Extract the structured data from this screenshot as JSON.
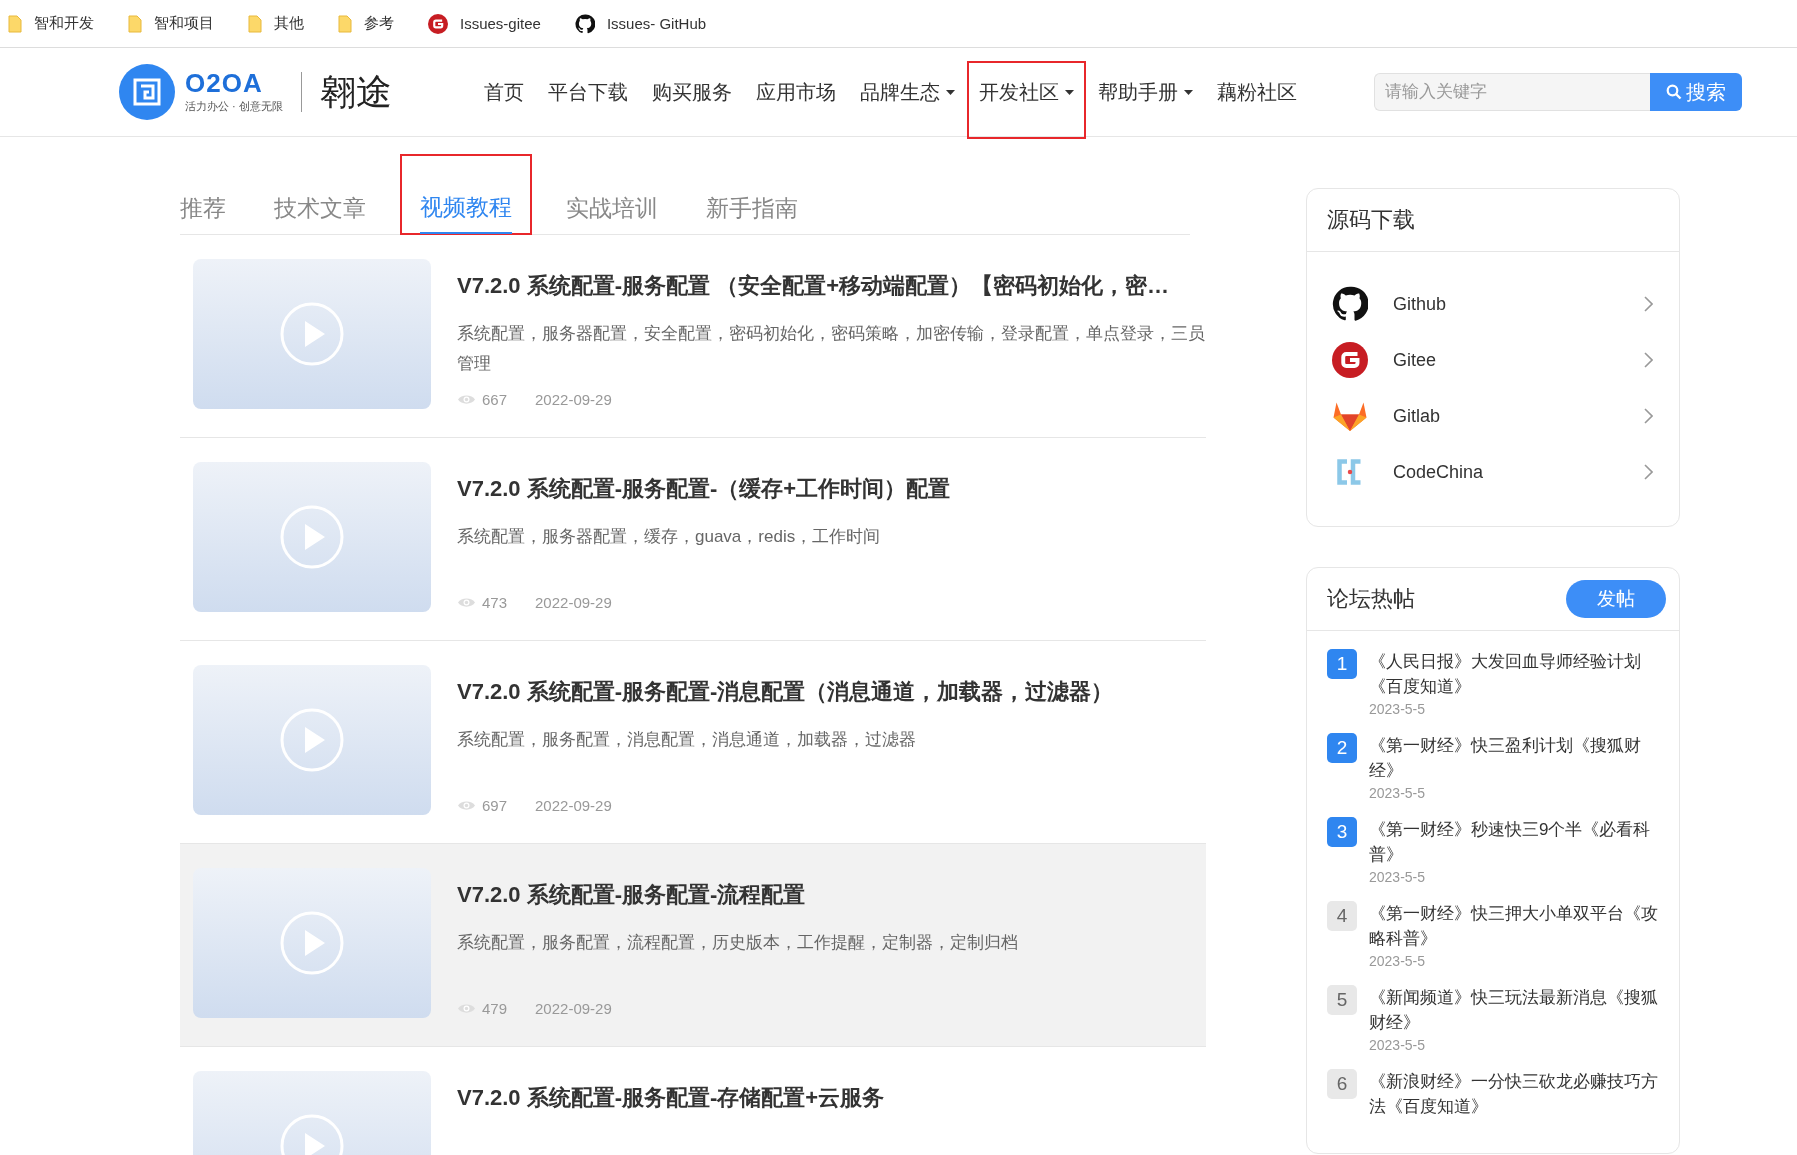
{
  "bookmarks": [
    {
      "kind": "folder",
      "label": "智和开发"
    },
    {
      "kind": "folder",
      "label": "智和项目"
    },
    {
      "kind": "folder",
      "label": "其他"
    },
    {
      "kind": "folder",
      "label": "参考"
    },
    {
      "kind": "gitee",
      "label": "Issues-gitee"
    },
    {
      "kind": "github",
      "label": "Issues- GitHub"
    }
  ],
  "header": {
    "logo": {
      "name": "O2OA",
      "slogan": "活力办公 · 创意无限",
      "brand": "翱途"
    },
    "nav": [
      {
        "label": "首页",
        "dropdown": false,
        "highlighted": false
      },
      {
        "label": "平台下载",
        "dropdown": false,
        "highlighted": false
      },
      {
        "label": "购买服务",
        "dropdown": false,
        "highlighted": false
      },
      {
        "label": "应用市场",
        "dropdown": false,
        "highlighted": false
      },
      {
        "label": "品牌生态",
        "dropdown": true,
        "highlighted": false
      },
      {
        "label": "开发社区",
        "dropdown": true,
        "highlighted": true
      },
      {
        "label": "帮助手册",
        "dropdown": true,
        "highlighted": false
      },
      {
        "label": "藕粉社区",
        "dropdown": false,
        "highlighted": false
      }
    ],
    "search": {
      "placeholder": "请输入关键字",
      "button": "搜索"
    }
  },
  "tabs": [
    {
      "label": "推荐",
      "selected": false,
      "highlighted": false
    },
    {
      "label": "技术文章",
      "selected": false,
      "highlighted": false
    },
    {
      "label": "视频教程",
      "selected": true,
      "highlighted": true
    },
    {
      "label": "实战培训",
      "selected": false,
      "highlighted": false
    },
    {
      "label": "新手指南",
      "selected": false,
      "highlighted": false
    }
  ],
  "videos": [
    {
      "title": "V7.2.0 系统配置-服务配置 （安全配置+移动端配置）【密码初始化，密…",
      "description": "系统配置，服务器配置，安全配置，密码初始化，密码策略，加密传输，登录配置，单点登录，三员管理",
      "views": "667",
      "date": "2022-09-29",
      "hovered": false
    },
    {
      "title": "V7.2.0 系统配置-服务配置-（缓存+工作时间）配置",
      "description": "系统配置，服务器配置，缓存，guava，redis，工作时间",
      "views": "473",
      "date": "2022-09-29",
      "hovered": false
    },
    {
      "title": "V7.2.0 系统配置-服务配置-消息配置（消息通道，加载器，过滤器）",
      "description": "系统配置，服务配置，消息配置，消息通道，加载器，过滤器",
      "views": "697",
      "date": "2022-09-29",
      "hovered": false
    },
    {
      "title": "V7.2.0 系统配置-服务配置-流程配置",
      "description": "系统配置，服务配置，流程配置，历史版本，工作提醒，定制器，定制归档",
      "views": "479",
      "date": "2022-09-29",
      "hovered": true
    },
    {
      "title": "V7.2.0 系统配置-服务配置-存储配置+云服务",
      "hovered": false
    }
  ],
  "source_download": {
    "title": "源码下载",
    "links": [
      {
        "kind": "github",
        "label": "Github"
      },
      {
        "kind": "gitee",
        "label": "Gitee"
      },
      {
        "kind": "gitlab",
        "label": "Gitlab"
      },
      {
        "kind": "codechina",
        "label": "CodeChina"
      }
    ]
  },
  "forum_hot": {
    "title": "论坛热帖",
    "button": "发帖",
    "posts": [
      {
        "rank": "1",
        "top": true,
        "title": "《人民日报》大发回血导师经验计划《百度知道》",
        "date": "2023-5-5"
      },
      {
        "rank": "2",
        "top": true,
        "title": "《第一财经》快三盈利计划《搜狐财经》",
        "date": "2023-5-5"
      },
      {
        "rank": "3",
        "top": true,
        "title": "《第一财经》秒速快三9个半《必看科普》",
        "date": "2023-5-5"
      },
      {
        "rank": "4",
        "top": false,
        "title": "《第一财经》快三押大小单双平台《攻略科普》",
        "date": "2023-5-5"
      },
      {
        "rank": "5",
        "top": false,
        "title": "《新闻频道》快三玩法最新消息《搜狐财经》",
        "date": "2023-5-5"
      },
      {
        "rank": "6",
        "top": false,
        "title": "《新浪财经》一分快三砍龙必赚技巧方法《百度知道》"
      }
    ]
  }
}
